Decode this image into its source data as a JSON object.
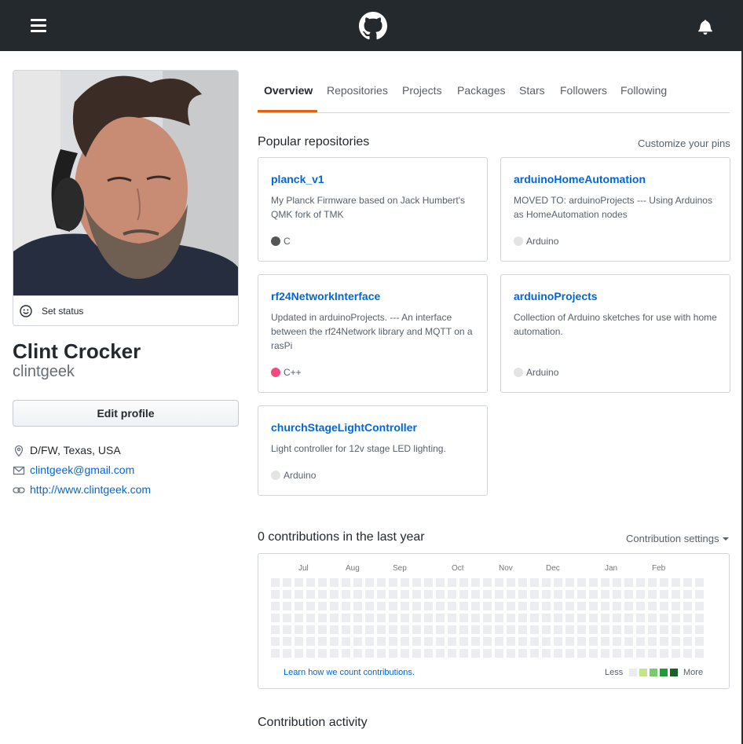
{
  "header": {
    "menu_icon": "hamburger-icon",
    "logo_icon": "github-mark-icon",
    "notifications_icon": "bell-icon"
  },
  "profile": {
    "fullname": "Clint Crocker",
    "username": "clintgeek",
    "set_status_label": "Set status",
    "edit_profile_label": "Edit profile",
    "location": "D/FW, Texas, USA",
    "email": "clintgeek@gmail.com",
    "website": "http://www.clintgeek.com"
  },
  "tabs": [
    {
      "label": "Overview",
      "active": true
    },
    {
      "label": "Repositories",
      "active": false
    },
    {
      "label": "Projects",
      "active": false
    },
    {
      "label": "Packages",
      "active": false
    },
    {
      "label": "Stars",
      "active": false
    },
    {
      "label": "Followers",
      "active": false
    },
    {
      "label": "Following",
      "active": false
    }
  ],
  "popular": {
    "title": "Popular repositories",
    "customize_label": "Customize your pins",
    "repos": [
      {
        "name": "planck_v1",
        "description": "My Planck Firmware based on Jack Humbert's QMK fork of TMK",
        "language": "C",
        "language_color": "#555555"
      },
      {
        "name": "arduinoHomeAutomation",
        "description": "MOVED TO: arduinoProjects --- Using Arduinos as HomeAutomation nodes",
        "language": "Arduino",
        "language_color": "#e4e4e4"
      },
      {
        "name": "rf24NetworkInterface",
        "description": "Updated in arduinoProjects. --- An interface between the rf24Network library and MQTT on a rasPi",
        "language": "C++",
        "language_color": "#f34b7d"
      },
      {
        "name": "arduinoProjects",
        "description": "Collection of Arduino sketches for use with home automation.",
        "language": "Arduino",
        "language_color": "#e4e4e4"
      },
      {
        "name": "churchStageLightController",
        "description": "Light controller for 12v stage LED lighting.",
        "language": "Arduino",
        "language_color": "#e4e4e4"
      }
    ]
  },
  "contributions": {
    "title": "0 contributions in the last year",
    "settings_label": "Contribution settings",
    "months": [
      "Jul",
      "Aug",
      "Sep",
      "Oct",
      "Nov",
      "Dec",
      "Jan",
      "Feb"
    ],
    "learn_label": "Learn how we count contributions.",
    "less_label": "Less",
    "more_label": "More",
    "empty_color": "#ebedf0",
    "legend_colors": [
      "#ebedf0",
      "#c6e48b",
      "#7bc96f",
      "#239a3b",
      "#196127"
    ]
  },
  "activity": {
    "title": "Contribution activity"
  }
}
